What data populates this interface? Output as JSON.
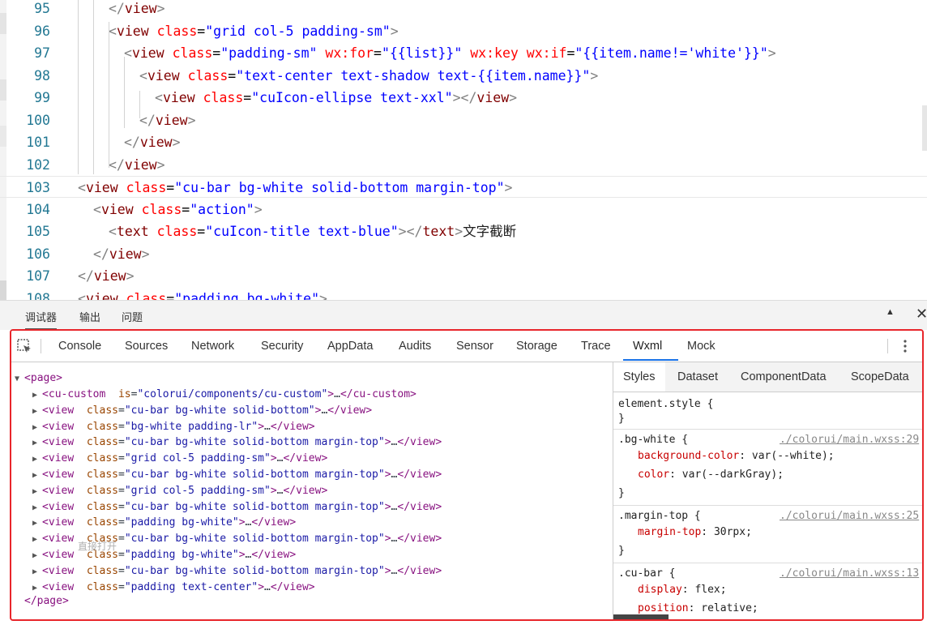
{
  "editor": {
    "lines": [
      {
        "num": "95",
        "segments": [
          {
            "c": "p",
            "t": "</"
          },
          {
            "c": "t",
            "t": "view"
          },
          {
            "c": "p",
            "t": ">"
          }
        ]
      },
      {
        "num": "96",
        "segments": [
          {
            "c": "p",
            "t": "<"
          },
          {
            "c": "t",
            "t": "view"
          },
          {
            "c": "x",
            "t": " "
          },
          {
            "c": "a",
            "t": "class"
          },
          {
            "c": "e",
            "t": "="
          },
          {
            "c": "v",
            "t": "\"grid col-5 padding-sm\""
          },
          {
            "c": "p",
            "t": ">"
          }
        ]
      },
      {
        "num": "97",
        "segments": [
          {
            "c": "p",
            "t": "<"
          },
          {
            "c": "t",
            "t": "view"
          },
          {
            "c": "x",
            "t": " "
          },
          {
            "c": "a",
            "t": "class"
          },
          {
            "c": "e",
            "t": "="
          },
          {
            "c": "v",
            "t": "\"padding-sm\""
          },
          {
            "c": "x",
            "t": " "
          },
          {
            "c": "a",
            "t": "wx:for"
          },
          {
            "c": "e",
            "t": "="
          },
          {
            "c": "v",
            "t": "\"{{list}}\""
          },
          {
            "c": "x",
            "t": " "
          },
          {
            "c": "a",
            "t": "wx:key"
          },
          {
            "c": "x",
            "t": " "
          },
          {
            "c": "a",
            "t": "wx:if"
          },
          {
            "c": "e",
            "t": "="
          },
          {
            "c": "v",
            "t": "\"{{item.name!='white'}}\""
          },
          {
            "c": "p",
            "t": ">"
          }
        ]
      },
      {
        "num": "98",
        "segments": [
          {
            "c": "p",
            "t": "<"
          },
          {
            "c": "t",
            "t": "view"
          },
          {
            "c": "x",
            "t": " "
          },
          {
            "c": "a",
            "t": "class"
          },
          {
            "c": "e",
            "t": "="
          },
          {
            "c": "v",
            "t": "\"text-center text-shadow text-{{item.name}}\""
          },
          {
            "c": "p",
            "t": ">"
          }
        ]
      },
      {
        "num": "99",
        "segments": [
          {
            "c": "p",
            "t": "<"
          },
          {
            "c": "t",
            "t": "view"
          },
          {
            "c": "x",
            "t": " "
          },
          {
            "c": "a",
            "t": "class"
          },
          {
            "c": "e",
            "t": "="
          },
          {
            "c": "v",
            "t": "\"cuIcon-ellipse text-xxl\""
          },
          {
            "c": "p",
            "t": "></"
          },
          {
            "c": "t",
            "t": "view"
          },
          {
            "c": "p",
            "t": ">"
          }
        ]
      },
      {
        "num": "100",
        "segments": [
          {
            "c": "p",
            "t": "</"
          },
          {
            "c": "t",
            "t": "view"
          },
          {
            "c": "p",
            "t": ">"
          }
        ]
      },
      {
        "num": "101",
        "segments": [
          {
            "c": "p",
            "t": "</"
          },
          {
            "c": "t",
            "t": "view"
          },
          {
            "c": "p",
            "t": ">"
          }
        ]
      },
      {
        "num": "102",
        "segments": [
          {
            "c": "p",
            "t": "</"
          },
          {
            "c": "t",
            "t": "view"
          },
          {
            "c": "p",
            "t": ">"
          }
        ]
      },
      {
        "num": "103",
        "segments": [
          {
            "c": "p",
            "t": "<"
          },
          {
            "c": "t",
            "t": "view"
          },
          {
            "c": "x",
            "t": " "
          },
          {
            "c": "a",
            "t": "class"
          },
          {
            "c": "e",
            "t": "="
          },
          {
            "c": "v",
            "t": "\"cu-bar bg-white solid-bottom margin-top\""
          },
          {
            "c": "p",
            "t": ">"
          }
        ]
      },
      {
        "num": "104",
        "segments": [
          {
            "c": "p",
            "t": "<"
          },
          {
            "c": "t",
            "t": "view"
          },
          {
            "c": "x",
            "t": " "
          },
          {
            "c": "a",
            "t": "class"
          },
          {
            "c": "e",
            "t": "="
          },
          {
            "c": "v",
            "t": "\"action\""
          },
          {
            "c": "p",
            "t": ">"
          }
        ]
      },
      {
        "num": "105",
        "segments": [
          {
            "c": "p",
            "t": "<"
          },
          {
            "c": "t",
            "t": "text"
          },
          {
            "c": "x",
            "t": " "
          },
          {
            "c": "a",
            "t": "class"
          },
          {
            "c": "e",
            "t": "="
          },
          {
            "c": "v",
            "t": "\"cuIcon-title text-blue\""
          },
          {
            "c": "p",
            "t": "></"
          },
          {
            "c": "t",
            "t": "text"
          },
          {
            "c": "p",
            "t": ">"
          },
          {
            "c": "x",
            "t": "文字截断"
          }
        ]
      },
      {
        "num": "106",
        "segments": [
          {
            "c": "p",
            "t": "</"
          },
          {
            "c": "t",
            "t": "view"
          },
          {
            "c": "p",
            "t": ">"
          }
        ]
      },
      {
        "num": "107",
        "segments": [
          {
            "c": "p",
            "t": "</"
          },
          {
            "c": "t",
            "t": "view"
          },
          {
            "c": "p",
            "t": ">"
          }
        ]
      },
      {
        "num": "108",
        "segments": [
          {
            "c": "p",
            "t": "<"
          },
          {
            "c": "t",
            "t": "view"
          },
          {
            "c": "x",
            "t": " "
          },
          {
            "c": "a",
            "t": "class"
          },
          {
            "c": "e",
            "t": "="
          },
          {
            "c": "v",
            "t": "\"padding bg-white\""
          },
          {
            "c": "p",
            "t": ">"
          }
        ]
      }
    ]
  },
  "panel": {
    "tabs": [
      "调试器",
      "输出",
      "问题"
    ],
    "up_glyph": "▲",
    "close_glyph": "✕"
  },
  "devtools": {
    "tabs": [
      "Console",
      "Sources",
      "Network",
      "Security",
      "AppData",
      "Audits",
      "Sensor",
      "Storage",
      "Trace",
      "Wxml",
      "Mock"
    ],
    "active_tab": "Wxml",
    "accent_color": "#1a73e8",
    "border_color": "#e8262b",
    "tree": {
      "root_open": "<page>",
      "root_close": "</page>",
      "ghost_text": "直接打开",
      "nodes": [
        {
          "tag": "cu-custom",
          "attr": "is",
          "value": "\"colorui/components/cu-custom\""
        },
        {
          "tag": "view",
          "attr": "class",
          "value": "\"cu-bar bg-white solid-bottom\""
        },
        {
          "tag": "view",
          "attr": "class",
          "value": "\"bg-white padding-lr\""
        },
        {
          "tag": "view",
          "attr": "class",
          "value": "\"cu-bar bg-white solid-bottom margin-top\""
        },
        {
          "tag": "view",
          "attr": "class",
          "value": "\"grid col-5 padding-sm\""
        },
        {
          "tag": "view",
          "attr": "class",
          "value": "\"cu-bar bg-white solid-bottom margin-top\""
        },
        {
          "tag": "view",
          "attr": "class",
          "value": "\"grid col-5 padding-sm\""
        },
        {
          "tag": "view",
          "attr": "class",
          "value": "\"cu-bar bg-white solid-bottom margin-top\""
        },
        {
          "tag": "view",
          "attr": "class",
          "value": "\"padding bg-white\""
        },
        {
          "tag": "view",
          "attr": "class",
          "value": "\"cu-bar bg-white solid-bottom margin-top\""
        },
        {
          "tag": "view",
          "attr": "class",
          "value": "\"padding bg-white\""
        },
        {
          "tag": "view",
          "attr": "class",
          "value": "\"cu-bar bg-white solid-bottom margin-top\""
        },
        {
          "tag": "view",
          "attr": "class",
          "value": "\"padding text-center\""
        }
      ]
    },
    "styles": {
      "tabs": [
        "Styles",
        "Dataset",
        "ComponentData",
        "ScopeData"
      ],
      "active_tab": "Styles",
      "rules": [
        {
          "selector": "element.style {",
          "source": "",
          "props": []
        },
        {
          "selector": ".bg-white {",
          "source": "./colorui/main.wxss:29",
          "props": [
            {
              "name": "background-color",
              "value": "var(--white);"
            },
            {
              "name": "color",
              "value": "var(--darkGray);"
            }
          ]
        },
        {
          "selector": ".margin-top {",
          "source": "./colorui/main.wxss:25",
          "props": [
            {
              "name": "margin-top",
              "value": "30rpx;"
            }
          ]
        },
        {
          "selector": ".cu-bar {",
          "source": "./colorui/main.wxss:13",
          "props": [
            {
              "name": "display",
              "value": "flex;"
            },
            {
              "name": "position",
              "value": "relative;"
            }
          ]
        }
      ]
    }
  }
}
